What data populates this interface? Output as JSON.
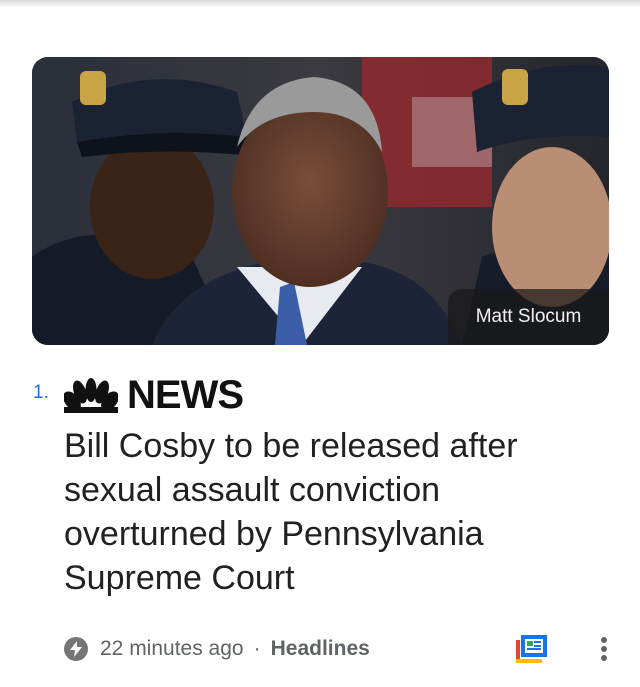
{
  "article": {
    "rank": "1.",
    "source_name": "NEWS",
    "image_credit": "Matt Slocum",
    "headline": "Bill Cosby to be released after sexual assault conviction overturned by Pennsylvania Supreme Court",
    "time_ago": "22 minutes ago",
    "separator": "·",
    "section": "Headlines"
  },
  "icons": {
    "source_logo": "nbc-peacock-icon",
    "time_badge": "bolt-icon",
    "newsstand": "newsstand-icon",
    "more": "more-vert-icon"
  },
  "colors": {
    "rank": "#1a73e8",
    "text": "#202124",
    "meta": "#5f6368"
  }
}
